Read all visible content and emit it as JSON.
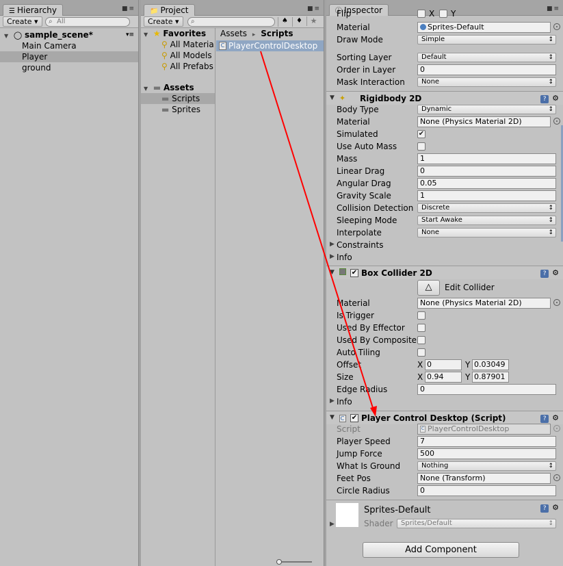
{
  "hierarchy": {
    "tab_label": "Hierarchy",
    "create_label": "Create",
    "search_placeholder": "All",
    "scene_name": "sample_scene*",
    "items": [
      {
        "label": "Main Camera"
      },
      {
        "label": "Player"
      },
      {
        "label": "ground"
      }
    ]
  },
  "project": {
    "tab_label": "Project",
    "create_label": "Create",
    "favorites_label": "Favorites",
    "favorites": [
      {
        "label": "All Materia"
      },
      {
        "label": "All Models"
      },
      {
        "label": "All Prefabs"
      }
    ],
    "assets_label": "Assets",
    "asset_folders": [
      {
        "label": "Scripts"
      },
      {
        "label": "Sprites"
      }
    ],
    "breadcrumb": {
      "root": "Assets",
      "sep": "▸",
      "current": "Scripts"
    },
    "files": [
      {
        "label": "PlayerControlDesktop"
      }
    ]
  },
  "inspector": {
    "tab_label": "Inspector",
    "sprite_renderer": {
      "flip_label": "Flip",
      "flip_x": "X",
      "flip_y": "Y",
      "material_label": "Material",
      "material_value": "Sprites-Default",
      "draw_mode_label": "Draw Mode",
      "draw_mode_value": "Simple",
      "sorting_layer_label": "Sorting Layer",
      "sorting_layer_value": "Default",
      "order_label": "Order in Layer",
      "order_value": "0",
      "mask_label": "Mask Interaction",
      "mask_value": "None"
    },
    "rigidbody": {
      "title": "Rigidbody 2D",
      "body_type_label": "Body Type",
      "body_type_value": "Dynamic",
      "material_label": "Material",
      "material_value": "None (Physics Material 2D)",
      "simulated_label": "Simulated",
      "auto_mass_label": "Use Auto Mass",
      "mass_label": "Mass",
      "mass_value": "1",
      "linear_drag_label": "Linear Drag",
      "linear_drag_value": "0",
      "angular_drag_label": "Angular Drag",
      "angular_drag_value": "0.05",
      "gravity_label": "Gravity Scale",
      "gravity_value": "1",
      "collision_label": "Collision Detection",
      "collision_value": "Discrete",
      "sleeping_label": "Sleeping Mode",
      "sleeping_value": "Start Awake",
      "interpolate_label": "Interpolate",
      "interpolate_value": "None",
      "constraints_label": "Constraints",
      "info_label": "Info"
    },
    "box_collider": {
      "title": "Box Collider 2D",
      "edit_label": "Edit Collider",
      "material_label": "Material",
      "material_value": "None (Physics Material 2D)",
      "trigger_label": "Is Trigger",
      "effector_label": "Used By Effector",
      "composite_label": "Used By Composite",
      "tiling_label": "Auto Tiling",
      "offset_label": "Offset",
      "offset_x": "0",
      "offset_y": "0.03049",
      "size_label": "Size",
      "size_x": "0.94",
      "size_y": "0.87901",
      "edge_label": "Edge Radius",
      "edge_value": "0",
      "x_label": "X",
      "y_label": "Y",
      "info_label": "Info"
    },
    "script": {
      "title": "Player Control Desktop (Script)",
      "script_label": "Script",
      "script_value": "PlayerControlDesktop",
      "speed_label": "Player Speed",
      "speed_value": "7",
      "jump_label": "Jump Force",
      "jump_value": "500",
      "ground_label": "What Is Ground",
      "ground_value": "Nothing",
      "feet_label": "Feet Pos",
      "feet_value": "None (Transform)",
      "radius_label": "Circle Radius",
      "radius_value": "0"
    },
    "material_preview": {
      "name": "Sprites-Default",
      "shader_label": "Shader",
      "shader_value": "Sprites/Default"
    },
    "add_component_label": "Add Component"
  },
  "colors": {
    "panel_bg": "#c2c2c2",
    "selection_blue": "#8fa6c3",
    "arrow_red": "#ff0000"
  }
}
